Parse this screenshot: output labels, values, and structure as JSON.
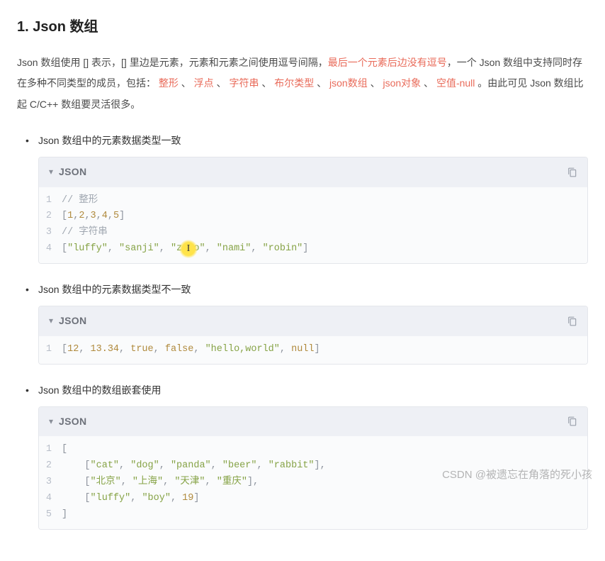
{
  "heading": "1. Json 数组",
  "intro": {
    "p1a": "Json 数组使用 [] 表示，[] 里边是元素，元素和元素之间使用逗号间隔，",
    "p1b": "最后一个元素后边没有逗号",
    "p1c": "，一个 Json 数组中支持同时存在多种不同类型的成员，包括：",
    "types": [
      "整形",
      "浮点",
      "字符串",
      "布尔类型",
      "json数组",
      "json对象",
      "空值-null"
    ],
    "sep": " 、 ",
    "p1d": " 。由此可见 Json 数组比起 C/C++ 数组要灵活很多。"
  },
  "items": [
    {
      "text": "Json 数组中的元素数据类型一致"
    },
    {
      "text": "Json 数组中的元素数据类型不一致"
    },
    {
      "text": "Json 数组中的数组嵌套使用"
    }
  ],
  "code_lang": "JSON",
  "code1": {
    "c1": "// 整形",
    "c2": "// 字符串",
    "nums": [
      "1",
      "2",
      "3",
      "4",
      "5"
    ],
    "strs": [
      "\"luffy\"",
      "\"sanji\"",
      "\"z  o\"",
      "\"nami\"",
      "\"robin\""
    ]
  },
  "code2": {
    "v1": "12",
    "v2": "13.34",
    "v3": "true",
    "v4": "false",
    "v5": "\"hello,world\"",
    "v6": "null"
  },
  "code3": {
    "r1": [
      "\"cat\"",
      "\"dog\"",
      "\"panda\"",
      "\"beer\"",
      "\"rabbit\""
    ],
    "r2": [
      "\"北京\"",
      "\"上海\"",
      "\"天津\"",
      "\"重庆\""
    ],
    "r3s": [
      "\"luffy\"",
      "\"boy\""
    ],
    "r3n": "19"
  },
  "watermark": "CSDN @被遗忘在角落的死小孩"
}
